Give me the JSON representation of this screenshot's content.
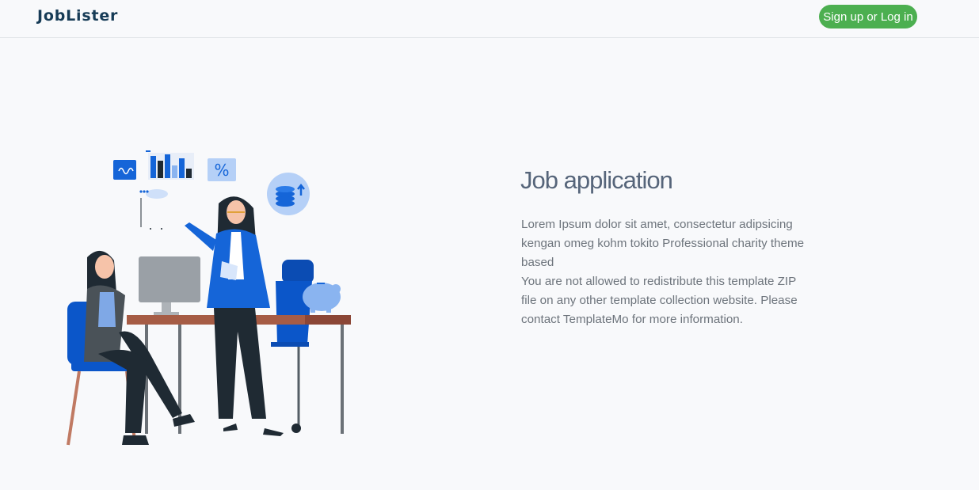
{
  "navbar": {
    "brand": "JobLister",
    "signup_label": "Sign up or Log in"
  },
  "hero": {
    "title": "Job application",
    "paragraph_1": "Lorem Ipsum dolor sit amet, consectetur adipsicing kengan omeg kohm tokito Professional charity theme based",
    "paragraph_2": "You are not allowed to redistribute this template ZIP file on any other template collection website. Please contact TemplateMo for more information.",
    "illustration_icons": {
      "chart_icon": "bar-chart-icon",
      "percent_icon": "percent-icon",
      "coins_icon": "coins-icon",
      "piggy_bank_icon": "piggy-bank-icon"
    },
    "percent_symbol": "%"
  },
  "colors": {
    "brand": "#163b56",
    "button": "#4caf50",
    "accent_blue": "#1565d8",
    "background": "#f8f9fb"
  }
}
